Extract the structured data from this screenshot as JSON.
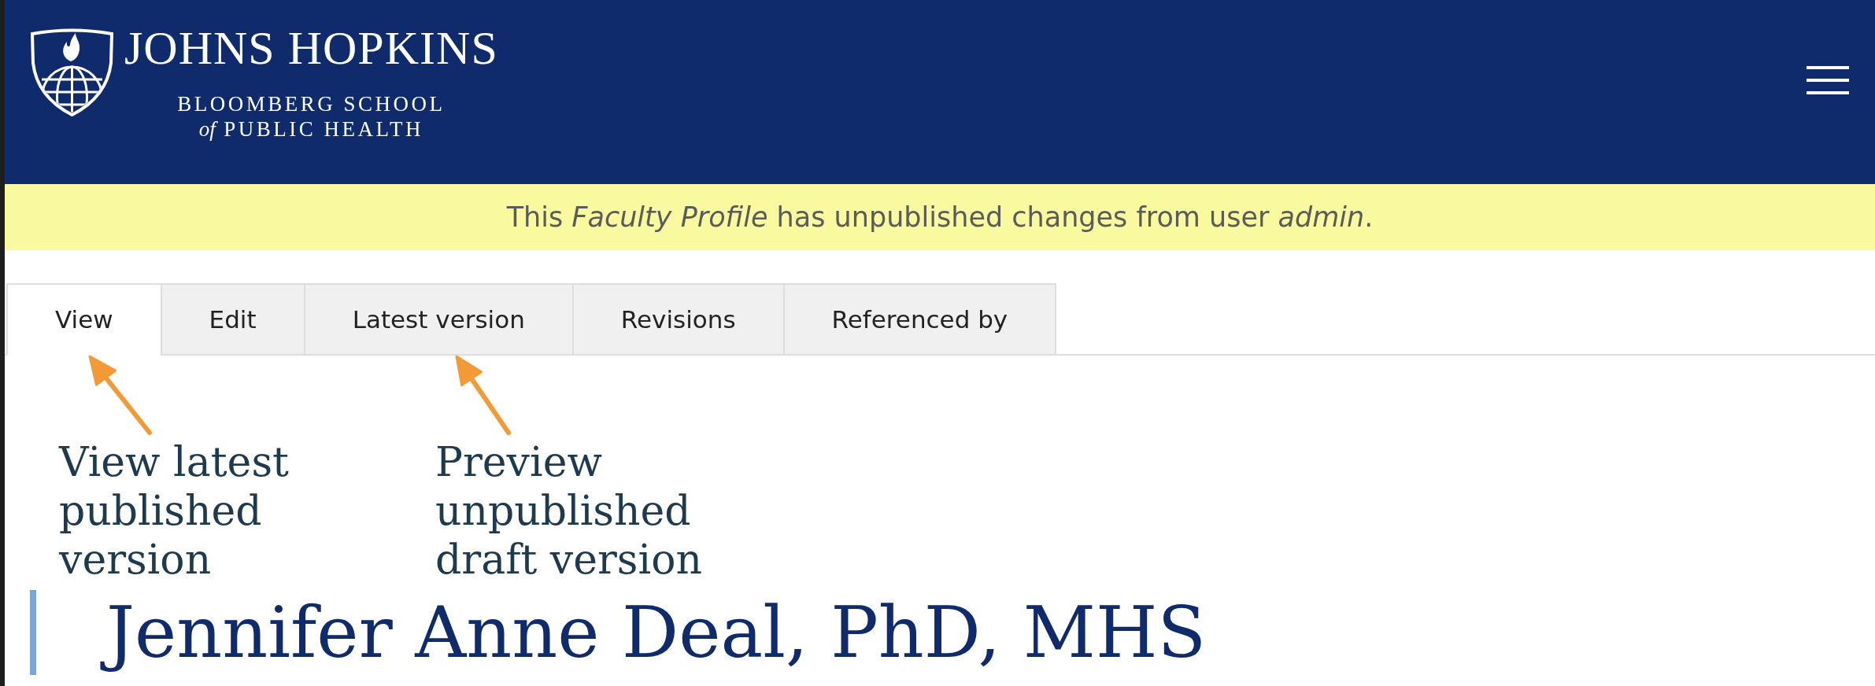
{
  "header": {
    "logo": {
      "title": "JOHNS HOPKINS",
      "subtitle_lines": [
        "BLOOMBERG SCHOOL",
        "*of* PUBLIC HEALTH"
      ]
    }
  },
  "notice": {
    "text": "This *Faculty Profile* has unpublished changes from user *admin*."
  },
  "tabs": [
    {
      "label": "View",
      "selected": true
    },
    {
      "label": "Edit",
      "selected": false
    },
    {
      "label": "Latest version",
      "selected": false
    },
    {
      "label": "Revisions",
      "selected": false
    },
    {
      "label": "Referenced by",
      "selected": false
    }
  ],
  "annotations": [
    {
      "lines": [
        "View latest",
        "published",
        "version"
      ]
    },
    {
      "lines": [
        "Preview",
        "unpublished",
        "draft version"
      ]
    }
  ],
  "profile": {
    "name": "Jennifer Anne Deal, PhD, MHS"
  }
}
